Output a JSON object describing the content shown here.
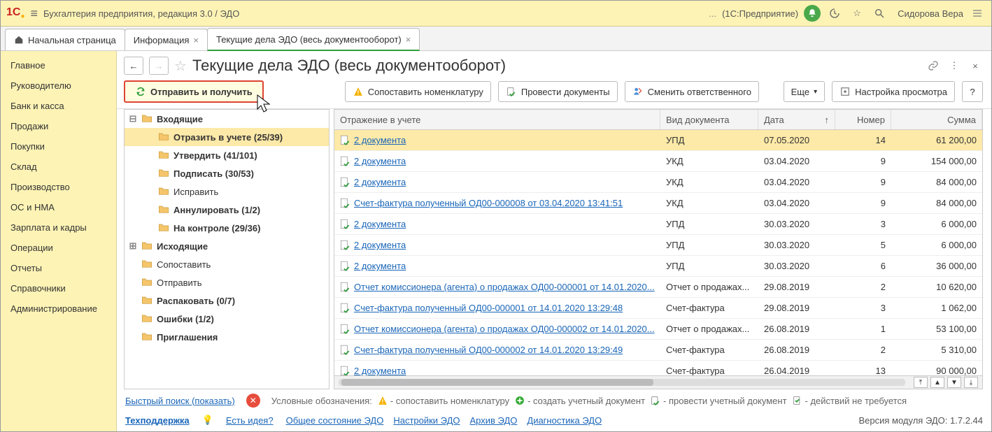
{
  "titlebar": {
    "app_title": "Бухгалтерия предприятия, редакция 3.0 / ЭДО",
    "right_dots": "...",
    "right_env": "(1С:Предприятие)",
    "user": "Сидорова Вера"
  },
  "tabs": {
    "home": "Начальная страница",
    "t1": "Информация",
    "t2": "Текущие дела ЭДО (весь документооборот)"
  },
  "leftnav": [
    "Главное",
    "Руководителю",
    "Банк и касса",
    "Продажи",
    "Покупки",
    "Склад",
    "Производство",
    "ОС и НМА",
    "Зарплата и кадры",
    "Операции",
    "Отчеты",
    "Справочники",
    "Администрирование"
  ],
  "page": {
    "title": "Текущие дела ЭДО (весь документооборот)"
  },
  "toolbar": {
    "send_recv": "Отправить и получить",
    "match_nomen": "Сопоставить номенклатуру",
    "post_docs": "Провести документы",
    "change_resp": "Сменить ответственного",
    "more": "Еще",
    "view_settings": "Настройка просмотра",
    "help": "?"
  },
  "tree": [
    {
      "toggle": "⊟",
      "label": "Входящие",
      "bold": true,
      "depth": 0
    },
    {
      "toggle": "",
      "label": "Отразить в учете (25/39)",
      "bold": true,
      "depth": 1,
      "sel": true
    },
    {
      "toggle": "",
      "label": "Утвердить (41/101)",
      "bold": true,
      "depth": 1
    },
    {
      "toggle": "",
      "label": "Подписать (30/53)",
      "bold": true,
      "depth": 1
    },
    {
      "toggle": "",
      "label": "Исправить",
      "bold": false,
      "depth": 1
    },
    {
      "toggle": "",
      "label": "Аннулировать (1/2)",
      "bold": true,
      "depth": 1
    },
    {
      "toggle": "",
      "label": "На контроле (29/36)",
      "bold": true,
      "depth": 1
    },
    {
      "toggle": "⊞",
      "label": "Исходящие",
      "bold": true,
      "depth": 0
    },
    {
      "toggle": "",
      "label": "Сопоставить",
      "bold": false,
      "depth": 0
    },
    {
      "toggle": "",
      "label": "Отправить",
      "bold": false,
      "depth": 0
    },
    {
      "toggle": "",
      "label": "Распаковать (0/7)",
      "bold": true,
      "depth": 0
    },
    {
      "toggle": "",
      "label": "Ошибки (1/2)",
      "bold": true,
      "depth": 0
    },
    {
      "toggle": "",
      "label": "Приглашения",
      "bold": true,
      "depth": 0
    }
  ],
  "grid": {
    "headers": {
      "c0": "Отражение в учете",
      "c1": "Вид документа",
      "c2": "Дата",
      "c3": "Номер",
      "c4": "Сумма"
    },
    "rows": [
      {
        "link": "2 документа",
        "kind": "УПД",
        "date": "07.05.2020",
        "num": "14",
        "sum": "61 200,00",
        "sel": true
      },
      {
        "link": "2 документа",
        "kind": "УКД",
        "date": "03.04.2020",
        "num": "9",
        "sum": "154 000,00"
      },
      {
        "link": "2 документа",
        "kind": "УКД",
        "date": "03.04.2020",
        "num": "9",
        "sum": "84 000,00"
      },
      {
        "link": "Счет-фактура полученный ОД00-000008 от 03.04.2020 13:41:51",
        "kind": "УКД",
        "date": "03.04.2020",
        "num": "9",
        "sum": "84 000,00"
      },
      {
        "link": "2 документа",
        "kind": "УПД",
        "date": "30.03.2020",
        "num": "3",
        "sum": "6 000,00"
      },
      {
        "link": "2 документа",
        "kind": "УПД",
        "date": "30.03.2020",
        "num": "5",
        "sum": "6 000,00"
      },
      {
        "link": "2 документа",
        "kind": "УПД",
        "date": "30.03.2020",
        "num": "6",
        "sum": "36 000,00"
      },
      {
        "link": "Отчет комиссионера (агента) о продажах ОД00-000001 от 14.01.2020...",
        "kind": "Отчет о продажах...",
        "date": "29.08.2019",
        "num": "2",
        "sum": "10 620,00"
      },
      {
        "link": "Счет-фактура полученный ОД00-000001 от 14.01.2020 13:29:48",
        "kind": "Счет-фактура",
        "date": "29.08.2019",
        "num": "3",
        "sum": "1 062,00"
      },
      {
        "link": "Отчет комиссионера (агента) о продажах ОД00-000002 от 14.01.2020...",
        "kind": "Отчет о продажах...",
        "date": "26.08.2019",
        "num": "1",
        "sum": "53 100,00"
      },
      {
        "link": "Счет-фактура полученный ОД00-000002 от 14.01.2020 13:29:49",
        "kind": "Счет-фактура",
        "date": "26.08.2019",
        "num": "2",
        "sum": "5 310,00"
      },
      {
        "link": "2 документа",
        "kind": "Счет-фактура",
        "date": "26.04.2019",
        "num": "13",
        "sum": "90 000,00"
      }
    ]
  },
  "footer1": {
    "quick_search": "Быстрый поиск (показать)",
    "legend_label": "Условные обозначения:",
    "lg1": "- сопоставить номенклатуру",
    "lg2": "- создать учетный документ",
    "lg3": "- провести учетный документ",
    "lg4": "- действий не требуется"
  },
  "footer2": {
    "support": "Техподдержка",
    "idea": "Есть идея?",
    "links": [
      "Общее состояние ЭДО",
      "Настройки ЭДО",
      "Архив ЭДО",
      "Диагностика ЭДО"
    ],
    "version": "Версия модуля ЭДО: 1.7.2.44"
  }
}
